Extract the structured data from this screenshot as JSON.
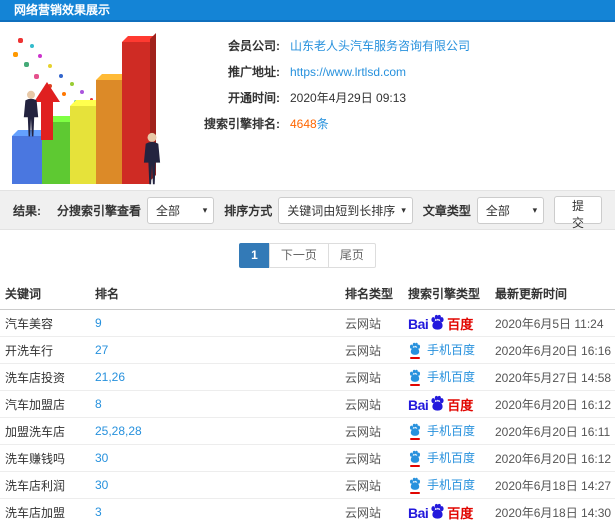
{
  "header": {
    "title": "网络营销效果展示"
  },
  "info": {
    "company_label": "会员公司:",
    "company_value": "山东老人头汽车服务咨询有限公司",
    "url_label": "推广地址:",
    "url_value": "https://www.lrtlsd.com",
    "open_time_label": "开通时间:",
    "open_time_value": "2020年4月29日 09:13",
    "rank_label": "搜索引擎排名:",
    "rank_count": "4648",
    "rank_unit": "条"
  },
  "filters": {
    "result_label": "结果:",
    "engine_filter_label": "分搜索引擎查看",
    "engine_filter_value": "全部",
    "sort_label": "排序方式",
    "sort_value": "关键词由短到长排序",
    "article_type_label": "文章类型",
    "article_type_value": "全部",
    "submit_label": "提交",
    "caret": "▾"
  },
  "pagination": {
    "current": "1",
    "next_label": "下一页",
    "last_label": "尾页"
  },
  "table": {
    "headers": [
      "关键词",
      "排名",
      "排名类型",
      "搜索引擎类型",
      "最新更新时间"
    ],
    "engine_labels": {
      "baidu_bai": "Bai",
      "baidu_cn": "百度",
      "mobile": "手机百度"
    },
    "rows": [
      {
        "keyword": "汽车美容",
        "rank": "9",
        "rank_type": "云网站",
        "engine": "baidu",
        "updated": "2020年6月5日 11:24"
      },
      {
        "keyword": "开洗车行",
        "rank": "27",
        "rank_type": "云网站",
        "engine": "mobile",
        "updated": "2020年6月20日 16:16"
      },
      {
        "keyword": "洗车店投资",
        "rank": "21,26",
        "rank_type": "云网站",
        "engine": "mobile",
        "updated": "2020年5月27日 14:58"
      },
      {
        "keyword": "汽车加盟店",
        "rank": "8",
        "rank_type": "云网站",
        "engine": "baidu",
        "updated": "2020年6月20日 16:12"
      },
      {
        "keyword": "加盟洗车店",
        "rank": "25,28,28",
        "rank_type": "云网站",
        "engine": "mobile",
        "updated": "2020年6月20日 16:11"
      },
      {
        "keyword": "洗车赚钱吗",
        "rank": "30",
        "rank_type": "云网站",
        "engine": "mobile",
        "updated": "2020年6月20日 16:12"
      },
      {
        "keyword": "洗车店利润",
        "rank": "30",
        "rank_type": "云网站",
        "engine": "mobile",
        "updated": "2020年6月18日 14:27"
      },
      {
        "keyword": "洗车店加盟",
        "rank": "3",
        "rank_type": "云网站",
        "engine": "baidu",
        "updated": "2020年6月18日 14:30"
      }
    ]
  },
  "colors": {
    "header_blue": "#1484d6",
    "link_blue": "#2791dd",
    "accent_orange": "#ff6600",
    "baidu_blue": "#2319dc",
    "baidu_red": "#e10601",
    "pagination_active": "#337ab7"
  },
  "illustration": {
    "bar_colors": [
      "#4a77e0",
      "#5ec932",
      "#e6e23a",
      "#dc8a28",
      "#cf2b24"
    ],
    "arrow_color": "#e02020"
  }
}
